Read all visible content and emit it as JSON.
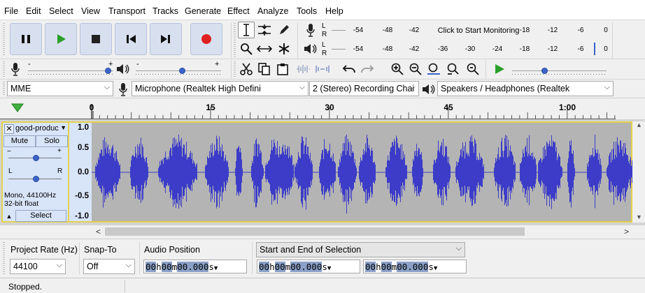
{
  "menu": [
    "File",
    "Edit",
    "Select",
    "View",
    "Transport",
    "Tracks",
    "Generate",
    "Effect",
    "Analyze",
    "Tools",
    "Help"
  ],
  "meters": {
    "record_lr": [
      "L",
      "R"
    ],
    "play_lr": [
      "L",
      "R"
    ],
    "record_ticks": [
      "-54",
      "-48",
      "-42",
      "Click to Start Monitoring",
      "-18",
      "-12",
      "-6",
      "0"
    ],
    "play_ticks": [
      "-54",
      "-48",
      "-42",
      "-36",
      "-30",
      "-24",
      "-18",
      "-12",
      "-6",
      "0"
    ]
  },
  "mixer": {
    "record_volume_minus": "-",
    "record_volume_plus": "+",
    "play_volume_minus": "-",
    "play_volume_plus": "+",
    "record_volume_level": 0.97,
    "play_volume_level": 0.56,
    "play_speed_level": 0.35
  },
  "devices": {
    "host": "MME",
    "mic": "Microphone (Realtek High Defini",
    "channels": "2 (Stereo) Recording Chai",
    "speakers": "Speakers / Headphones (Realtek"
  },
  "ruler": {
    "labels": [
      "0",
      "15",
      "30",
      "45",
      "1:00"
    ]
  },
  "track": {
    "name": "good-produc",
    "mute": "Mute",
    "solo": "Solo",
    "gain_minus": "−",
    "gain_plus": "+",
    "pan_left": "L",
    "pan_right": "R",
    "info_line1": "Mono, 44100Hz",
    "info_line2": "32-bit float",
    "select": "Select",
    "scale": [
      "1.0",
      "0.5",
      "0.0",
      "-0.5",
      "-1.0"
    ],
    "wave_color": "#3c3cc8"
  },
  "selection_toolbar": {
    "project_rate_label": "Project Rate (Hz)",
    "project_rate_value": "44100",
    "snap_to_label": "Snap-To",
    "snap_to_value": "Off",
    "audio_position_label": "Audio Position",
    "selection_mode": "Start and End of Selection",
    "audio_position": [
      "00",
      "h",
      "00",
      "m",
      "00.000",
      "s"
    ],
    "selection_start": [
      "00",
      "h",
      "00",
      "m",
      "00.000",
      "s"
    ],
    "selection_end": [
      "00",
      "h",
      "00",
      "m",
      "00.000",
      "s"
    ]
  },
  "status": "Stopped.",
  "colors": {
    "record_red": "#e02020",
    "play_green": "#2aa02a",
    "track_border": "#e2d34a",
    "button_face": "#d8e0f0"
  }
}
